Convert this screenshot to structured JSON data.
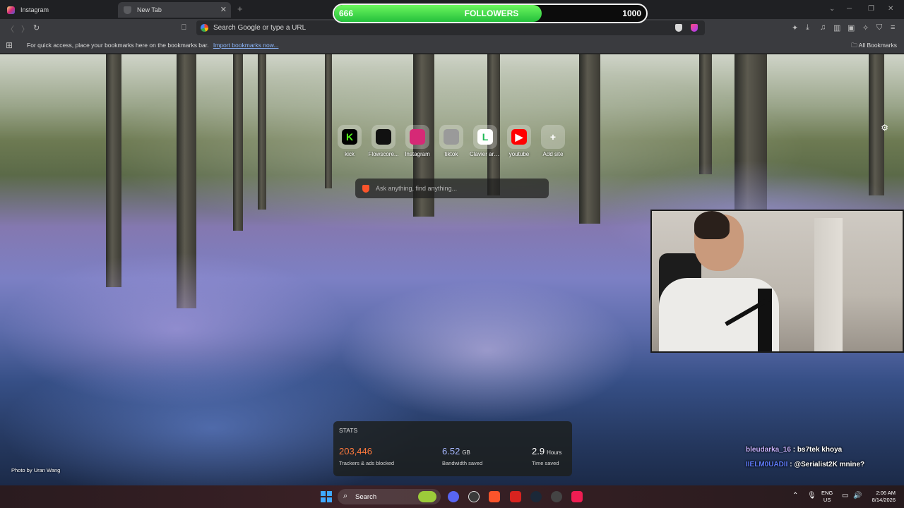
{
  "tabs": [
    {
      "title": "Instagram",
      "active": false
    },
    {
      "title": "New Tab",
      "active": true
    }
  ],
  "followers_overlay": {
    "current": "666",
    "label": "FOLLOWERS",
    "goal": "1000",
    "progress_fraction": 0.666,
    "fill_color": "#3cd94a"
  },
  "toolbar": {
    "omnibox_placeholder": "Search Google or type a URL"
  },
  "bookmarks_bar": {
    "hint_text": "For quick access, place your bookmarks here on the bookmarks bar.",
    "import_link": "Import bookmarks now...",
    "all_bookmarks": "All Bookmarks"
  },
  "shortcuts": [
    {
      "label": "kick",
      "icon": "kick-icon",
      "letter": "K",
      "bg": "#000000",
      "fg": "#53fc18"
    },
    {
      "label": "Flowscore...",
      "icon": "flowscore-icon",
      "letter": "",
      "bg": "#111111",
      "fg": "#2ee6b0"
    },
    {
      "label": "Instagram",
      "icon": "instagram-icon",
      "letter": "",
      "bg": "#d62976",
      "fg": "#ffffff"
    },
    {
      "label": "tiktok",
      "icon": "globe-icon",
      "letter": "",
      "bg": "#9a9a9a",
      "fg": "#ffffff"
    },
    {
      "label": "Clavier ara...",
      "icon": "clavier-icon",
      "letter": "L",
      "bg": "#ffffff",
      "fg": "#1db954"
    },
    {
      "label": "youtube",
      "icon": "youtube-icon",
      "letter": "▶",
      "bg": "#ff0000",
      "fg": "#ffffff"
    },
    {
      "label": "Add site",
      "icon": "plus-icon",
      "letter": "+",
      "bg": "transparent",
      "fg": "#ffffff"
    }
  ],
  "ask_box": {
    "placeholder": "Ask anything, find anything..."
  },
  "stats": {
    "title": "STATS",
    "items": [
      {
        "value": "203,446",
        "unit": "",
        "label": "Trackers & ads blocked",
        "color": "#ff7a3d"
      },
      {
        "value": "6.52",
        "unit": "GB",
        "label": "Bandwidth saved",
        "color": "#a7b8ff"
      },
      {
        "value": "2.9",
        "unit": "Hours",
        "label": "Time saved",
        "color": "#ffffff"
      }
    ]
  },
  "photo_credit": "Photo by Uran Wang",
  "chat": [
    {
      "user": "bleudarka_16",
      "message": " : bs7tek khoya"
    },
    {
      "user": "IIELM0UADII",
      "message": " : @Serialist2K mnine?"
    }
  ],
  "taskbar": {
    "search_label": "Search",
    "lang_line1": "ENG",
    "lang_line2": "US",
    "time": "2:06 AM",
    "date": "8/14/2026"
  }
}
